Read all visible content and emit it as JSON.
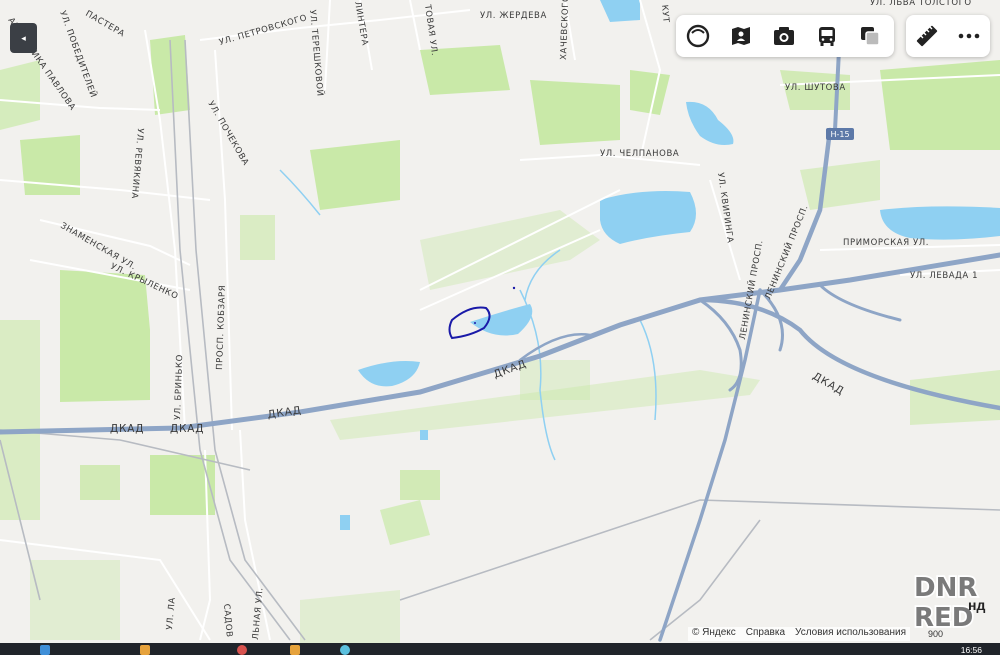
{
  "map": {
    "streets": {
      "pastera": "ПАСТЕРА",
      "akademika_pavlova": "АКАДЕМИКА ПАВЛОВА",
      "pobeditelei": "УЛ. ПОБЕДИТЕЛЕЙ",
      "petrovskogo": "УЛ. ПЕТРОВСКОГО",
      "tereshkovoi": "УЛ. ТЕРЕШКОВОЙ",
      "linter": "ЛИНТЕРА",
      "tovaya": "ТОВАЯ УЛ.",
      "zherdeva": "УЛ. ЖЕРДЕВА",
      "khachevskogo": "ХАЧЕВСКОГО",
      "kut": "КУТ",
      "lva_tolstogo": "УЛ. ЛЬВА ТОЛСТОГО",
      "shutova": "УЛ. ШУТОВА",
      "pochekova": "УЛ. ПОЧЕКОВА",
      "revyakina": "УЛ. РЕВЯКИНА",
      "chelpanova": "УЛ. ЧЕЛПАНОВА",
      "kviringa": "УЛ. КВИРИНГА",
      "znamenskaya": "ЗНАМЕНСКАЯ УЛ.",
      "krylenko": "УЛ. КРЫЛЕНКО",
      "leninsky_1": "ЛЕНИНСКИЙ ПРОСП.",
      "leninsky_2": "ЛЕНИНСКИЙ ПРОСП.",
      "primorskaya": "ПРИМОРСКАЯ УЛ.",
      "levada": "УЛ. ЛЕВАДА 1",
      "kobzarya": "ПРОСП. КОБЗАРЯ",
      "brinko": "УЛ. БРИНЬКО",
      "sadovaya": "САДОВ",
      "lnaya": "ЛЬНАЯ УЛ.",
      "ul_la": "УЛ. ЛА",
      "dkad_1": "ДКАД",
      "dkad_2": "ДКАД",
      "dkad_3": "ДКАД",
      "dkad_4": "ДКАД",
      "dkad_5": "ДКАД",
      "h15": "H-15"
    },
    "colors": {
      "land": "#f2f1ee",
      "green": "#c9e9a8",
      "water": "#8fd0f2",
      "highway": "#8ea5c6",
      "road": "#ffffff",
      "selection": "#1a1aa8"
    }
  },
  "controls": {
    "back_icon": "◂",
    "toolbar_icons": [
      "layers-icon",
      "panorama-icon",
      "photo-icon",
      "transport-icon",
      "map-type-icon"
    ],
    "ruler_icon": "ruler-icon",
    "more_icon": "more-icon"
  },
  "footer": {
    "copyright": "© Яндекс",
    "help": "Справка",
    "terms": "Условия использования",
    "scale": "900",
    "partial": "нд"
  },
  "taskbar": {
    "clock": "16:56"
  },
  "watermark": {
    "line1": "DNR",
    "line2": "RED"
  }
}
